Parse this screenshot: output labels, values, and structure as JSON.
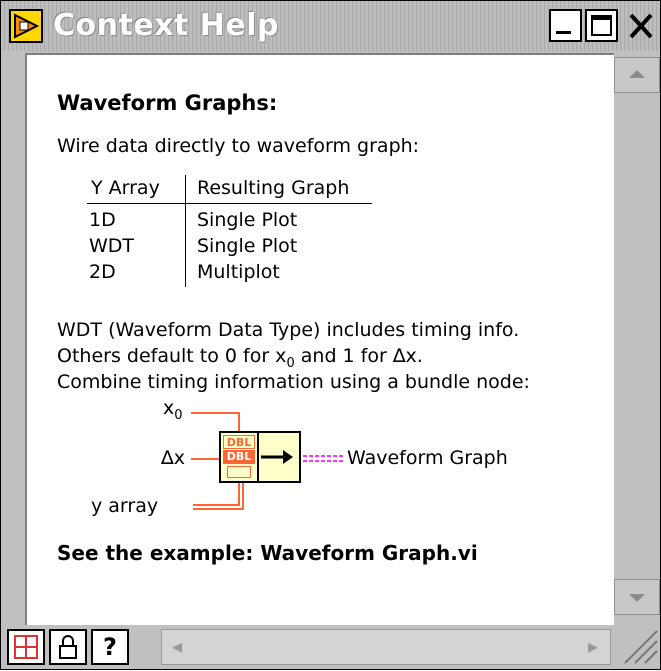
{
  "window": {
    "title": "Context Help",
    "close_glyph": "✕"
  },
  "help": {
    "heading": "Waveform Graphs:",
    "intro": "Wire data directly to waveform graph:",
    "table": {
      "headers": [
        "Y Array",
        "Resulting Graph"
      ],
      "rows": [
        [
          "1D",
          "Single Plot"
        ],
        [
          "WDT",
          "Single Plot"
        ],
        [
          "2D",
          "Multiplot"
        ]
      ]
    },
    "note_line1": "WDT (Waveform Data Type) includes timing info.",
    "note_line2_a": "Others default to 0 for x",
    "note_line2_sub": "0",
    "note_line2_b": " and 1 for ∆x.",
    "note_line3": "Combine timing information using a bundle node:",
    "diagram": {
      "input_x0": "x",
      "input_x0_sub": "0",
      "input_dx": "∆x",
      "input_y": "y array",
      "terminal_type_1": "DBL",
      "terminal_type_2": "DBL",
      "output": "Waveform Graph"
    },
    "example": "See the example: Waveform Graph.vi"
  },
  "bottom_bar": {
    "question": "?"
  },
  "icons": [
    "window-icon",
    "minimize-icon",
    "maximize-icon",
    "close-icon",
    "scroll-up-icon",
    "scroll-down-icon",
    "hierarchy-icon",
    "lock-icon",
    "help-icon",
    "scroll-left-icon",
    "scroll-right-icon",
    "resize-grip-icon"
  ],
  "colors": {
    "wire_orange": "#ff6633",
    "wire_pink": "#ff33ff",
    "node_fill": "#ffffcc"
  }
}
